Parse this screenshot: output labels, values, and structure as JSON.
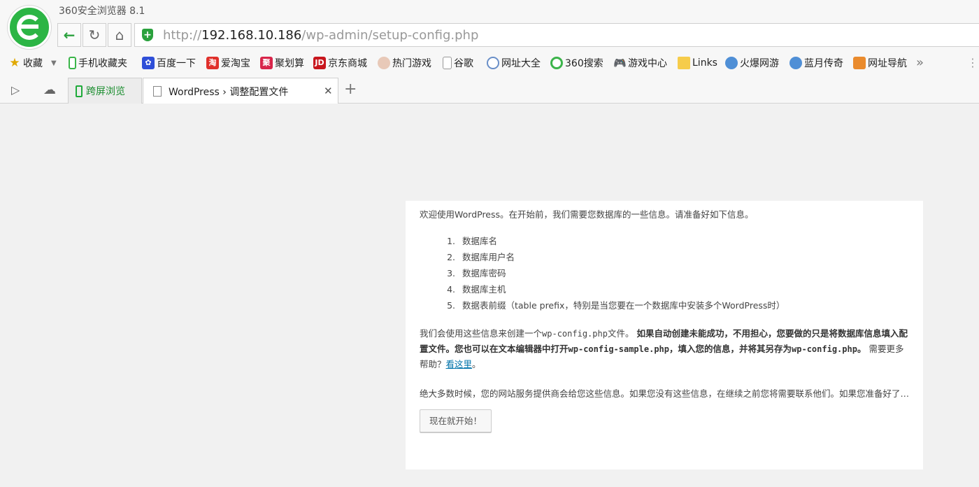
{
  "browser": {
    "app_title": "360安全浏览器 8.1",
    "url_scheme": "http://",
    "url_host": "192.168.10.186",
    "url_path": "/wp-admin/setup-config.php"
  },
  "bookmarks": [
    {
      "label": "收藏",
      "icon": "star-icon"
    },
    {
      "label": "手机收藏夹",
      "icon": "phone-icon"
    },
    {
      "label": "百度一下",
      "icon": "baidu-icon"
    },
    {
      "label": "爱淘宝",
      "icon": "taobao-icon"
    },
    {
      "label": "聚划算",
      "icon": "juhuasuan-icon"
    },
    {
      "label": "京东商城",
      "icon": "jd-icon"
    },
    {
      "label": "热门游戏",
      "icon": "game-avatar-icon"
    },
    {
      "label": "谷歌",
      "icon": "page-icon"
    },
    {
      "label": "网址大全",
      "icon": "globe-icon"
    },
    {
      "label": "360搜索",
      "icon": "360-search-icon"
    },
    {
      "label": "游戏中心",
      "icon": "gamepad-icon"
    },
    {
      "label": "Links",
      "icon": "folder-icon"
    },
    {
      "label": "火爆网游",
      "icon": "game-icon"
    },
    {
      "label": "蓝月传奇",
      "icon": "game-icon"
    },
    {
      "label": "网址导航",
      "icon": "2345-icon"
    }
  ],
  "tabs": {
    "cross_screen": "跨屏浏览",
    "active": "WordPress › 调整配置文件"
  },
  "setup": {
    "intro": "欢迎使用WordPress。在开始前，我们需要您数据库的一些信息。请准备好如下信息。",
    "items": [
      {
        "num": "1.",
        "text": "数据库名"
      },
      {
        "num": "2.",
        "text": "数据库用户名"
      },
      {
        "num": "3.",
        "text": "数据库密码"
      },
      {
        "num": "4.",
        "text": "数据库主机"
      },
      {
        "num": "5.",
        "text": "数据表前缀（table prefix，特别是当您要在一个数据库中安装多个WordPress时）"
      }
    ],
    "p2_a": "我们会使用这些信息来创建一个",
    "p2_file1": "wp-config.php",
    "p2_b": "文件。",
    "p2_bold_a": "如果自动创建未能成功，不用担心，您要做的只是将数据库信息填入配置文件。您也可以在文本编辑器中打开",
    "p2_file2": "wp-config-sample.php",
    "p2_bold_b": "，填入您的信息，并将其另存为",
    "p2_file3": "wp-config.php",
    "p2_bold_c": "。",
    "p2_help": "需要更多帮助？",
    "p2_link": "看这里",
    "p2_end": "。",
    "p3": "绝大多数时候，您的网站服务提供商会给您这些信息。如果您没有这些信息，在继续之前您将需要联系他们。如果您准备好了…",
    "button": "现在就开始！"
  }
}
